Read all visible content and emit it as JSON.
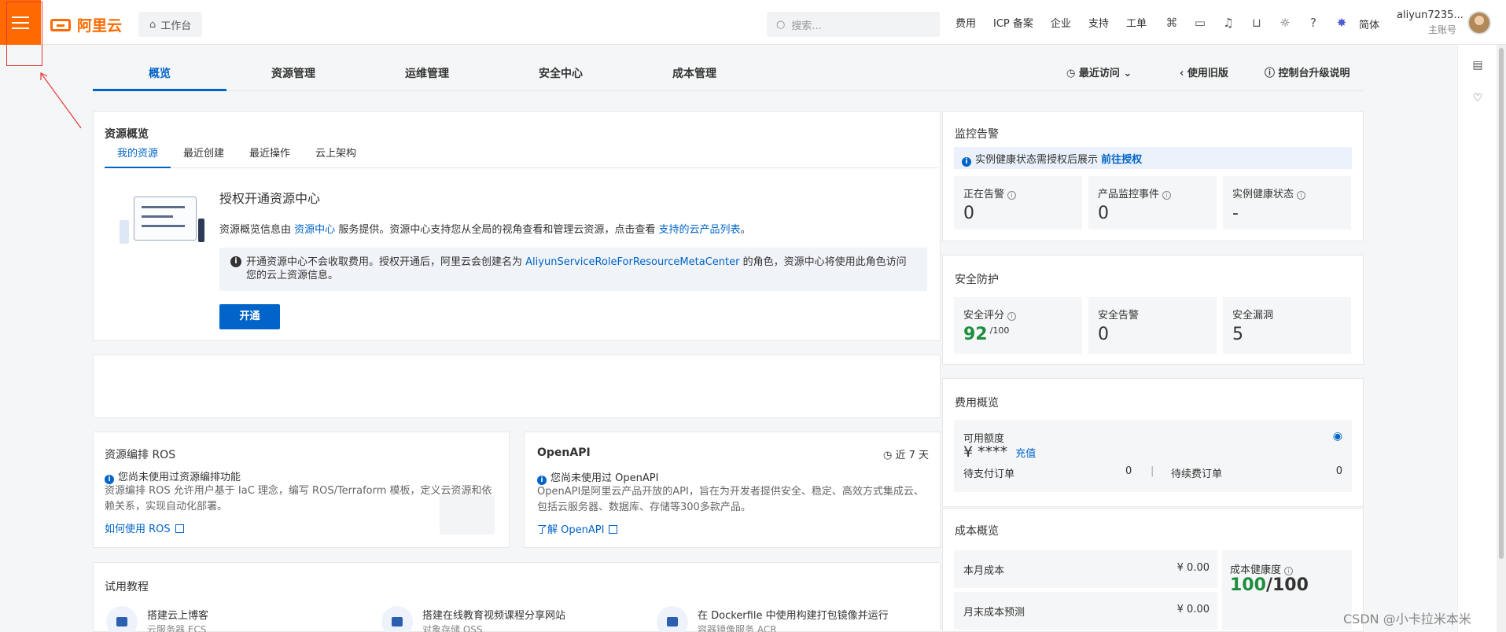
{
  "topbar": {
    "logo_text": "阿里云",
    "workbench": "工作台",
    "search_placeholder": "搜索...",
    "nav": [
      "费用",
      "ICP 备案",
      "企业",
      "支持",
      "工单"
    ],
    "lang": "简体",
    "account_name": "aliyun7235...",
    "account_role": "主账号"
  },
  "tabs": {
    "overview": "概览",
    "resource": "资源管理",
    "ops": "运维管理",
    "security": "安全中心",
    "cost": "成本管理",
    "recent": "最近访问",
    "old_version": "使用旧版",
    "upgrade": "控制台升级说明"
  },
  "resource_overview": {
    "title": "资源概览",
    "subtabs": [
      "我的资源",
      "最近创建",
      "最近操作",
      "云上架构"
    ],
    "auth_title": "授权开通资源中心",
    "desc_prefix": "资源概览信息由",
    "desc_link1": "资源中心",
    "desc_mid": "服务提供。资源中心支持您从全局的视角查看和管理云资源，点击查看",
    "desc_link2": "支持的云产品列表",
    "desc_end": "。",
    "notice_prefix": "开通资源中心不会收取费用。授权开通后，阿里云会创建名为",
    "notice_role": "AliyunServiceRoleForResourceMetaCenter",
    "notice_suffix": "的角色，资源中心将使用此角色访问您的云上资源信息。",
    "open_button": "开通"
  },
  "ros": {
    "title": "资源编排 ROS",
    "status": "您尚未使用过资源编排功能",
    "desc": "资源编排 ROS 允许用户基于 IaC 理念，编写 ROS/Terraform 模板，定义云资源和依赖关系，实现自动化部署。",
    "link": "如何使用 ROS"
  },
  "openapi": {
    "title": "OpenAPI",
    "range": "近 7 天",
    "status": "您尚未使用过 OpenAPI",
    "desc": "OpenAPI是阿里云产品开放的API，旨在为开发者提供安全、稳定、高效方式集成云、包括云服务器、数据库、存储等300多款产品。",
    "link": "了解 OpenAPI"
  },
  "tutorials": {
    "title": "试用教程",
    "items": [
      {
        "title": "搭建云上博客",
        "sub": "云服务器 ECS"
      },
      {
        "title": "搭建在线教育视频课程分享网站",
        "sub": "对象存储 OSS"
      },
      {
        "title": "在 Dockerfile 中使用构建打包镜像并运行",
        "sub": "容器镜像服务 ACR"
      }
    ]
  },
  "monitor": {
    "title": "监控告警",
    "notice": "实例健康状态需授权后展示",
    "notice_link": "前往授权",
    "metrics": [
      {
        "label": "正在告警",
        "value": "0"
      },
      {
        "label": "产品监控事件",
        "value": "0"
      },
      {
        "label": "实例健康状态",
        "value": "-"
      }
    ]
  },
  "security": {
    "title": "安全防护",
    "metrics": [
      {
        "label": "安全评分",
        "value": "92",
        "unit": "/100"
      },
      {
        "label": "安全告警",
        "value": "0"
      },
      {
        "label": "安全漏洞",
        "value": "5"
      }
    ]
  },
  "billing": {
    "title": "费用概览",
    "available_label": "可用额度",
    "available_value": "¥ ****",
    "recharge": "充值",
    "pending_pay_label": "待支付订单",
    "pending_pay_value": "0",
    "pending_renew_label": "待续费订单",
    "pending_renew_value": "0"
  },
  "cost": {
    "title": "成本概览",
    "month_label": "本月成本",
    "month_value": "¥ 0.00",
    "forecast_label": "月末成本预测",
    "forecast_value": "¥ 0.00",
    "health_label": "成本健康度",
    "health_value": "100",
    "health_unit": "/100"
  },
  "watermark": "CSDN @小卡拉米本米",
  "colors": {
    "brand": "#ff6a00",
    "link": "#0064c8",
    "good": "#1e8e3e"
  }
}
